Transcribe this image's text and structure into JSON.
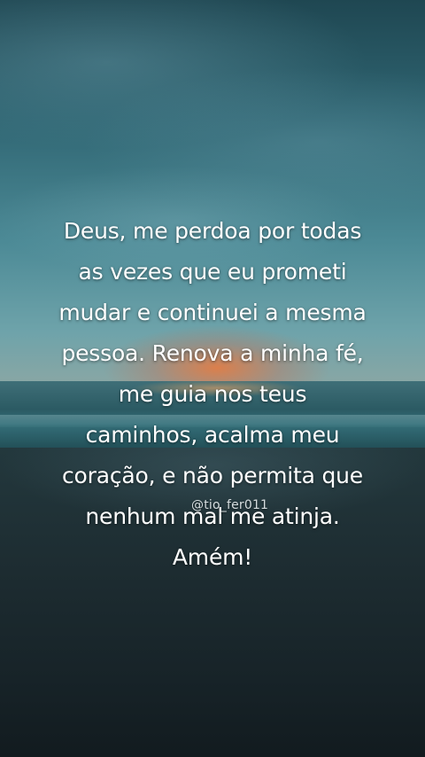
{
  "quote": {
    "lines": [
      "Deus, me perdoa por todas",
      "as vezes que eu prometi",
      "mudar e continuei a mesma",
      "pessoa. Renova a minha fé,",
      "me guia nos teus",
      "caminhos, acalma meu",
      "coração, e não permita que",
      "nenhum mal me atinja.",
      "Amém!"
    ]
  },
  "watermark": {
    "handle": "@tio_fer011"
  },
  "colors": {
    "text": "#ffffff",
    "sky_top": "#1f4752",
    "sunset_glow": "#eb783c",
    "beach": "#172328"
  }
}
